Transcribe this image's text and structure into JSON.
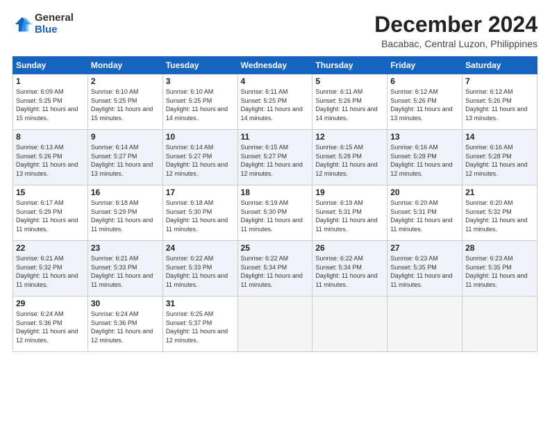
{
  "logo": {
    "general": "General",
    "blue": "Blue"
  },
  "header": {
    "month_title": "December 2024",
    "subtitle": "Bacabac, Central Luzon, Philippines"
  },
  "weekdays": [
    "Sunday",
    "Monday",
    "Tuesday",
    "Wednesday",
    "Thursday",
    "Friday",
    "Saturday"
  ],
  "weeks": [
    [
      {
        "day": 1,
        "sunrise": "6:09 AM",
        "sunset": "5:25 PM",
        "daylight": "11 hours and 15 minutes."
      },
      {
        "day": 2,
        "sunrise": "6:10 AM",
        "sunset": "5:25 PM",
        "daylight": "11 hours and 15 minutes."
      },
      {
        "day": 3,
        "sunrise": "6:10 AM",
        "sunset": "5:25 PM",
        "daylight": "11 hours and 14 minutes."
      },
      {
        "day": 4,
        "sunrise": "6:11 AM",
        "sunset": "5:25 PM",
        "daylight": "11 hours and 14 minutes."
      },
      {
        "day": 5,
        "sunrise": "6:11 AM",
        "sunset": "5:26 PM",
        "daylight": "11 hours and 14 minutes."
      },
      {
        "day": 6,
        "sunrise": "6:12 AM",
        "sunset": "5:26 PM",
        "daylight": "11 hours and 13 minutes."
      },
      {
        "day": 7,
        "sunrise": "6:12 AM",
        "sunset": "5:26 PM",
        "daylight": "11 hours and 13 minutes."
      }
    ],
    [
      {
        "day": 8,
        "sunrise": "6:13 AM",
        "sunset": "5:26 PM",
        "daylight": "11 hours and 13 minutes."
      },
      {
        "day": 9,
        "sunrise": "6:14 AM",
        "sunset": "5:27 PM",
        "daylight": "11 hours and 13 minutes."
      },
      {
        "day": 10,
        "sunrise": "6:14 AM",
        "sunset": "5:27 PM",
        "daylight": "11 hours and 12 minutes."
      },
      {
        "day": 11,
        "sunrise": "6:15 AM",
        "sunset": "5:27 PM",
        "daylight": "11 hours and 12 minutes."
      },
      {
        "day": 12,
        "sunrise": "6:15 AM",
        "sunset": "5:28 PM",
        "daylight": "11 hours and 12 minutes."
      },
      {
        "day": 13,
        "sunrise": "6:16 AM",
        "sunset": "5:28 PM",
        "daylight": "11 hours and 12 minutes."
      },
      {
        "day": 14,
        "sunrise": "6:16 AM",
        "sunset": "5:28 PM",
        "daylight": "11 hours and 12 minutes."
      }
    ],
    [
      {
        "day": 15,
        "sunrise": "6:17 AM",
        "sunset": "5:29 PM",
        "daylight": "11 hours and 11 minutes."
      },
      {
        "day": 16,
        "sunrise": "6:18 AM",
        "sunset": "5:29 PM",
        "daylight": "11 hours and 11 minutes."
      },
      {
        "day": 17,
        "sunrise": "6:18 AM",
        "sunset": "5:30 PM",
        "daylight": "11 hours and 11 minutes."
      },
      {
        "day": 18,
        "sunrise": "6:19 AM",
        "sunset": "5:30 PM",
        "daylight": "11 hours and 11 minutes."
      },
      {
        "day": 19,
        "sunrise": "6:19 AM",
        "sunset": "5:31 PM",
        "daylight": "11 hours and 11 minutes."
      },
      {
        "day": 20,
        "sunrise": "6:20 AM",
        "sunset": "5:31 PM",
        "daylight": "11 hours and 11 minutes."
      },
      {
        "day": 21,
        "sunrise": "6:20 AM",
        "sunset": "5:32 PM",
        "daylight": "11 hours and 11 minutes."
      }
    ],
    [
      {
        "day": 22,
        "sunrise": "6:21 AM",
        "sunset": "5:32 PM",
        "daylight": "11 hours and 11 minutes."
      },
      {
        "day": 23,
        "sunrise": "6:21 AM",
        "sunset": "5:33 PM",
        "daylight": "11 hours and 11 minutes."
      },
      {
        "day": 24,
        "sunrise": "6:22 AM",
        "sunset": "5:33 PM",
        "daylight": "11 hours and 11 minutes."
      },
      {
        "day": 25,
        "sunrise": "6:22 AM",
        "sunset": "5:34 PM",
        "daylight": "11 hours and 11 minutes."
      },
      {
        "day": 26,
        "sunrise": "6:22 AM",
        "sunset": "5:34 PM",
        "daylight": "11 hours and 11 minutes."
      },
      {
        "day": 27,
        "sunrise": "6:23 AM",
        "sunset": "5:35 PM",
        "daylight": "11 hours and 11 minutes."
      },
      {
        "day": 28,
        "sunrise": "6:23 AM",
        "sunset": "5:35 PM",
        "daylight": "11 hours and 11 minutes."
      }
    ],
    [
      {
        "day": 29,
        "sunrise": "6:24 AM",
        "sunset": "5:36 PM",
        "daylight": "11 hours and 12 minutes."
      },
      {
        "day": 30,
        "sunrise": "6:24 AM",
        "sunset": "5:36 PM",
        "daylight": "11 hours and 12 minutes."
      },
      {
        "day": 31,
        "sunrise": "6:25 AM",
        "sunset": "5:37 PM",
        "daylight": "11 hours and 12 minutes."
      },
      null,
      null,
      null,
      null
    ]
  ]
}
